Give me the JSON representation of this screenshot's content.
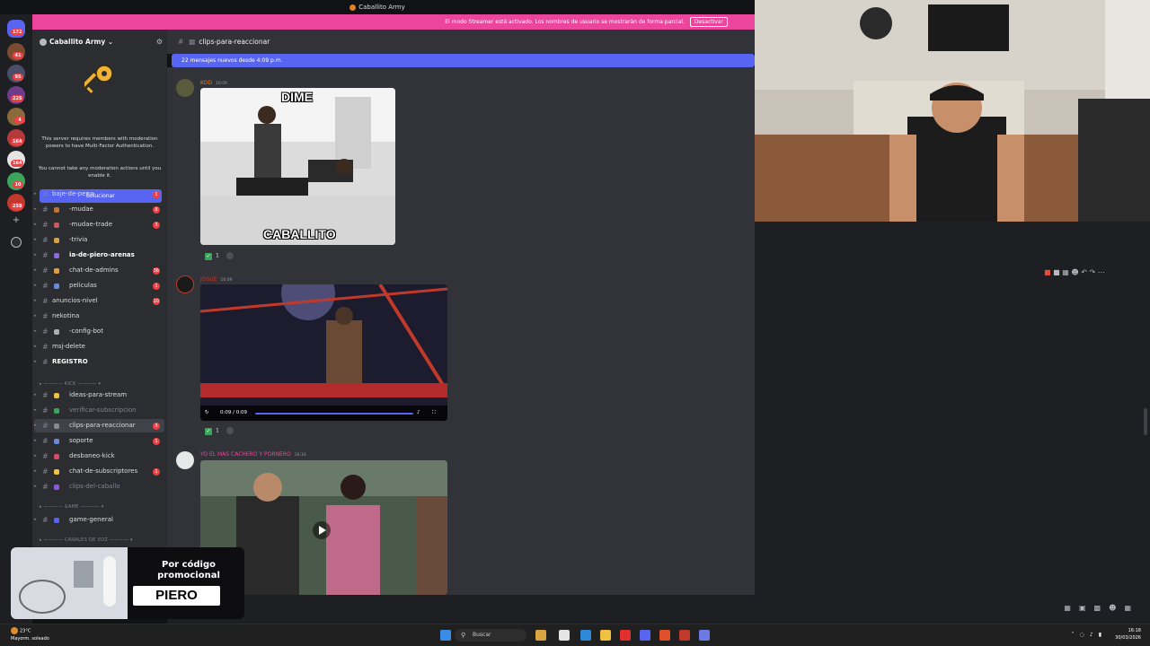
{
  "window": {
    "title": "Caballito Army"
  },
  "banner": {
    "text": "El modo Streamer está activado. Los nombres de usuario se mostrarán de forma parcial.",
    "button": "Desactivar"
  },
  "rail": {
    "badges": [
      "172",
      "41",
      "95",
      "225",
      "4",
      "164",
      "164",
      "10",
      "258"
    ]
  },
  "server": {
    "name": "Caballito Army"
  },
  "mfa": {
    "text": "This server requires members with moderation powers to have Multi-Factor Authentication.",
    "text2": "You cannot take any moderation actions until you enable it.",
    "button": "Solucionar"
  },
  "categories": {
    "kick": "KICK",
    "game": "GAME",
    "voice": "CANALES DE VOZ"
  },
  "channels": [
    {
      "name": "baje-de-pepa",
      "badge": "1"
    },
    {
      "name": "-mudae",
      "badge": "8"
    },
    {
      "name": "-mudae-trade",
      "badge": "3"
    },
    {
      "name": "-trivia",
      "badge": ""
    },
    {
      "name": "ia-de-piero-arenas",
      "badge": ""
    },
    {
      "name": "chat-de-admins",
      "badge": "36"
    },
    {
      "name": "peliculas",
      "badge": "1"
    },
    {
      "name": "anuncios-nivel",
      "badge": "10"
    },
    {
      "name": "nekotina",
      "badge": ""
    },
    {
      "name": "-config-bot",
      "badge": ""
    },
    {
      "name": "msj-delete",
      "badge": ""
    },
    {
      "name": "REGISTRO",
      "badge": ""
    },
    {
      "name": "ideas-para-stream",
      "badge": ""
    },
    {
      "name": "verificar-subscripcion",
      "badge": ""
    },
    {
      "name": "clips-para-reaccionar",
      "badge": "3"
    },
    {
      "name": "soporte",
      "badge": "1"
    },
    {
      "name": "desbaneo-kick",
      "badge": ""
    },
    {
      "name": "chat-de-subscriptores",
      "badge": "1"
    },
    {
      "name": "clips-del-caballo",
      "badge": ""
    },
    {
      "name": "game-general",
      "badge": ""
    }
  ],
  "channel_header": {
    "name": "clips-para-reaccionar"
  },
  "new_messages": "22 mensajes nuevos desde 4:09 p.m.",
  "messages": [
    {
      "user": "KOD",
      "time": "16:09",
      "caption_top": "DIME",
      "caption_bottom": "CABALLITO",
      "reaction_count": "1"
    },
    {
      "user": "JOSUE",
      "time": "16:09",
      "video_time": "0:09 / 0:09",
      "reaction_count": "1"
    },
    {
      "user": "YO EL MAS CACHERO Y PORNERO",
      "time": "16:10"
    }
  ],
  "promo": {
    "line1": "Por código promocional",
    "code": "PIERO"
  },
  "taskbar": {
    "weather_temp": "23°C",
    "weather_desc": "Mayorm. soleado",
    "search": "Buscar",
    "time": "16:18",
    "date": "30/03/2026"
  },
  "colors": {
    "accent": "#5865f2",
    "banner": "#eb459e",
    "badge": "#f23f43"
  }
}
